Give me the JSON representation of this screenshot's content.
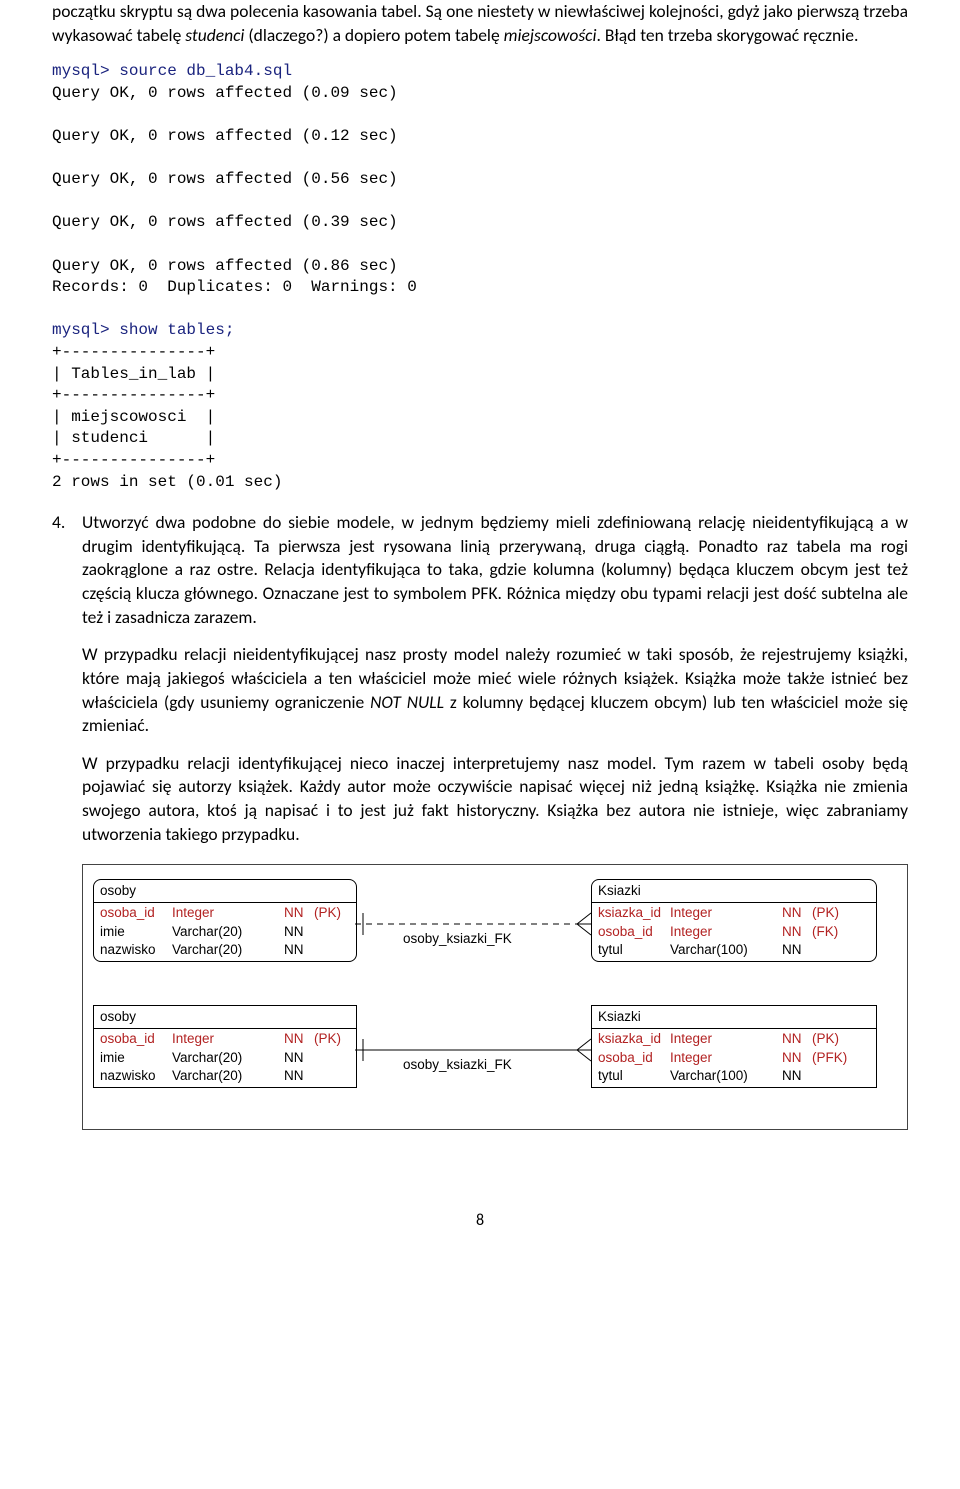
{
  "para1_a": "początku skryptu są dwa polecenia kasowania tabel. Są one niestety w niewłaściwej kolejności, gdyż jako pierwszą trzeba wykasować tabelę ",
  "para1_em1": "studenci",
  "para1_b": " (dlaczego?) a dopiero potem tabelę ",
  "para1_em2": "miejscowości",
  "para1_c": ". Błąd ten trzeba skorygować ręcznie.",
  "code": {
    "l1": "mysql> source db_lab4.sql",
    "l2": "Query OK, 0 rows affected (0.09 sec)",
    "l3": "Query OK, 0 rows affected (0.12 sec)",
    "l4": "Query OK, 0 rows affected (0.56 sec)",
    "l5": "Query OK, 0 rows affected (0.39 sec)",
    "l6": "Query OK, 0 rows affected (0.86 sec)",
    "l7": "Records: 0  Duplicates: 0  Warnings: 0",
    "l8": "mysql> show tables;",
    "l9": "+---------------+",
    "l10": "| Tables_in_lab |",
    "l11": "+---------------+",
    "l12": "| miejscowosci  |",
    "l13": "| studenci      |",
    "l14": "+---------------+",
    "l15": "2 rows in set (0.01 sec)"
  },
  "item4_num": "4.",
  "item4_p1": "Utworzyć dwa podobne do siebie modele, w jednym będziemy mieli zdefiniowaną relację nieidentyfikującą a w drugim identyfikującą. Ta pierwsza jest rysowana linią przerywaną, druga ciągłą. Ponadto raz tabela ma rogi zaokrąglone a raz ostre. Relacja identyfikująca to taka, gdzie kolumna (kolumny) będąca kluczem obcym jest też częścią klucza głównego. Oznaczane jest to symbolem PFK. Różnica między obu typami relacji jest dość subtelna ale też i zasadnicza zarazem.",
  "item4_p2_a": "W przypadku relacji nieidentyfikującej nasz prosty model należy rozumieć w taki sposób, że rejestrujemy książki, które mają jakiegoś właściciela a ten właściciel może mieć wiele różnych książek. Książka może także istnieć bez właściciela (gdy usuniemy ograniczenie ",
  "item4_p2_em": "NOT NULL",
  "item4_p2_b": " z kolumny będącej kluczem obcym) lub ten właściciel może się zmieniać.",
  "item4_p3": "W przypadku relacji identyfikującej nieco inaczej interpretujemy nasz model. Tym razem w tabeli osoby będą pojawiać się autorzy książek. Każdy autor może oczywiście napisać więcej niż jedną książkę. Książka nie zmienia swojego autora, ktoś ją napisać i to jest już fakt historyczny. Książka bez autora nie istnieje, więc zabraniamy utworzenia takiego przypadku.",
  "diag": {
    "osoby_title": "osoby",
    "osoby": {
      "r1": {
        "name": "osoba_id",
        "type": "Integer",
        "nn": "NN",
        "key": "(PK)"
      },
      "r2": {
        "name": "imie",
        "type": "Varchar(20)",
        "nn": "NN",
        "key": ""
      },
      "r3": {
        "name": "nazwisko",
        "type": "Varchar(20)",
        "nn": "NN",
        "key": ""
      }
    },
    "ksiazki_title": "Ksiazki",
    "ksiazki1": {
      "r1": {
        "name": "ksiazka_id",
        "type": "Integer",
        "nn": "NN",
        "key": "(PK)"
      },
      "r2": {
        "name": "osoba_id",
        "type": "Integer",
        "nn": "NN",
        "key": "(FK)"
      },
      "r3": {
        "name": "tytul",
        "type": "Varchar(100)",
        "nn": "NN",
        "key": ""
      }
    },
    "ksiazki2": {
      "r1": {
        "name": "ksiazka_id",
        "type": "Integer",
        "nn": "NN",
        "key": "(PK)"
      },
      "r2": {
        "name": "osoba_id",
        "type": "Integer",
        "nn": "NN",
        "key": "(PFK)"
      },
      "r3": {
        "name": "tytul",
        "type": "Varchar(100)",
        "nn": "NN",
        "key": ""
      }
    },
    "rel_label": "osoby_ksiazki_FK"
  },
  "page_num": "8"
}
